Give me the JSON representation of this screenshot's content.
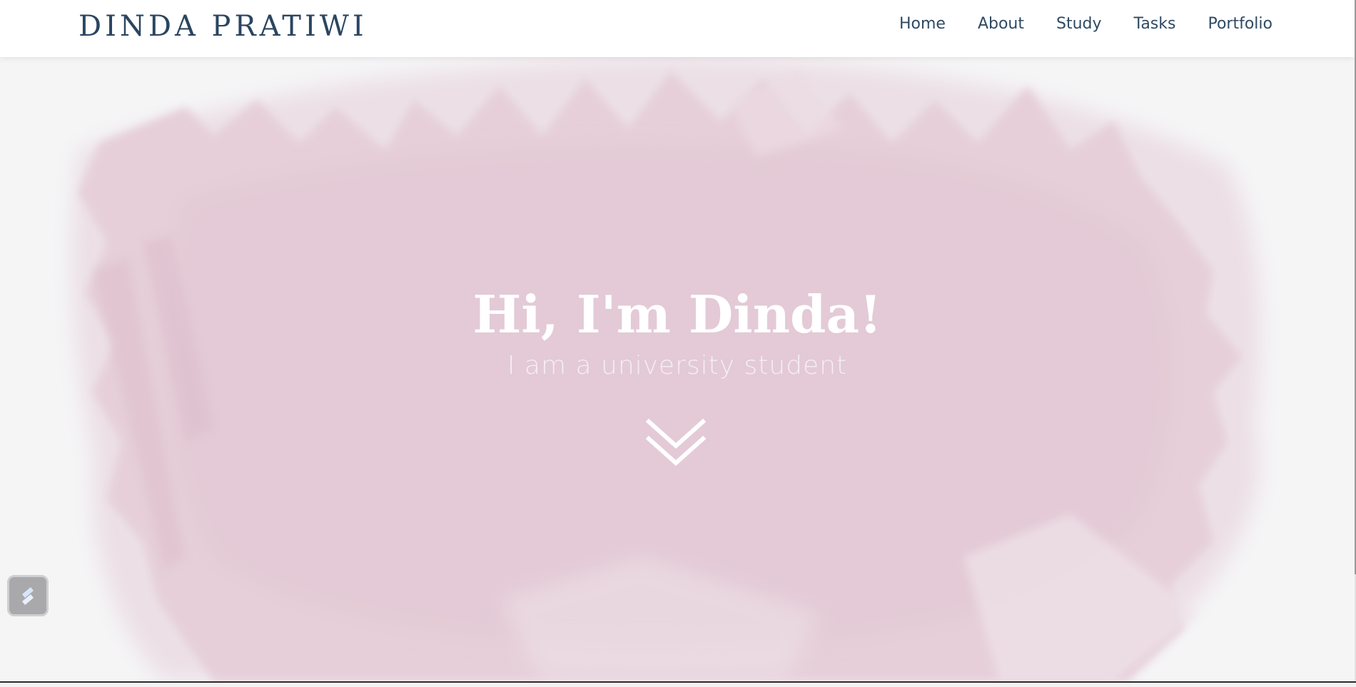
{
  "header": {
    "brand": "DINDA PRATIWI",
    "nav": [
      {
        "label": "Home"
      },
      {
        "label": "About"
      },
      {
        "label": "Study"
      },
      {
        "label": "Tasks"
      },
      {
        "label": "Portfolio"
      }
    ]
  },
  "hero": {
    "headline": "Hi, I'm Dinda!",
    "subline": "I am a university student",
    "scroll_icon": "double-chevron-down-icon"
  },
  "widget": {
    "icon": "stripe-logo-icon"
  },
  "colors": {
    "brand": "#2a4560",
    "nav_text": "#2f4a63",
    "brush_pink": "#e4ccd7",
    "page_bg": "#f5f5f6",
    "hero_text": "#ffffff"
  }
}
